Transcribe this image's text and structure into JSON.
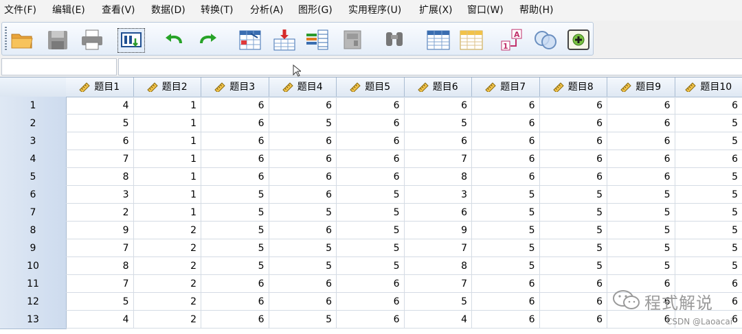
{
  "menu": [
    {
      "id": "file",
      "label": "文件(F)"
    },
    {
      "id": "edit",
      "label": "编辑(E)"
    },
    {
      "id": "view",
      "label": "查看(V)"
    },
    {
      "id": "data",
      "label": "数据(D)"
    },
    {
      "id": "transform",
      "label": "转换(T)"
    },
    {
      "id": "analyze",
      "label": "分析(A)"
    },
    {
      "id": "graphs",
      "label": "图形(G)"
    },
    {
      "id": "utilities",
      "label": "实用程序(U)"
    },
    {
      "id": "extensions",
      "label": "扩展(X)"
    },
    {
      "id": "window",
      "label": "窗口(W)"
    },
    {
      "id": "help",
      "label": "帮助(H)"
    }
  ],
  "toolbar": {
    "icons": [
      "open-folder-icon",
      "save-icon",
      "print-icon",
      "dialog-recall-icon",
      "undo-icon",
      "redo-icon",
      "goto-case-icon",
      "goto-variable-icon",
      "variables-icon",
      "run-descriptives-icon",
      "find-icon",
      "insert-cases-icon",
      "insert-variable-icon",
      "split-file-icon",
      "value-labels-icon",
      "use-sets-icon",
      "show-all-variables-icon"
    ]
  },
  "cell_editor": {
    "name": "",
    "value": ""
  },
  "grid": {
    "columns": [
      "题目1",
      "题目2",
      "题目3",
      "题目4",
      "题目5",
      "题目6",
      "题目7",
      "题目8",
      "题目9",
      "题目10"
    ],
    "rows": [
      {
        "n": "1",
        "values": [
          "4",
          "1",
          "6",
          "6",
          "6",
          "6",
          "6",
          "6",
          "6",
          "6"
        ]
      },
      {
        "n": "2",
        "values": [
          "5",
          "1",
          "6",
          "5",
          "6",
          "5",
          "6",
          "6",
          "6",
          "5"
        ]
      },
      {
        "n": "3",
        "values": [
          "6",
          "1",
          "6",
          "6",
          "6",
          "6",
          "6",
          "6",
          "6",
          "5"
        ]
      },
      {
        "n": "4",
        "values": [
          "7",
          "1",
          "6",
          "6",
          "6",
          "7",
          "6",
          "6",
          "6",
          "6"
        ]
      },
      {
        "n": "5",
        "values": [
          "8",
          "1",
          "6",
          "6",
          "6",
          "8",
          "6",
          "6",
          "6",
          "5"
        ]
      },
      {
        "n": "6",
        "values": [
          "3",
          "1",
          "5",
          "6",
          "5",
          "3",
          "5",
          "5",
          "5",
          "5"
        ]
      },
      {
        "n": "7",
        "values": [
          "2",
          "1",
          "5",
          "5",
          "5",
          "6",
          "5",
          "5",
          "5",
          "5"
        ]
      },
      {
        "n": "8",
        "values": [
          "9",
          "2",
          "5",
          "6",
          "5",
          "9",
          "5",
          "5",
          "5",
          "5"
        ]
      },
      {
        "n": "9",
        "values": [
          "7",
          "2",
          "5",
          "5",
          "5",
          "7",
          "5",
          "5",
          "5",
          "5"
        ]
      },
      {
        "n": "10",
        "values": [
          "8",
          "2",
          "5",
          "5",
          "5",
          "8",
          "5",
          "5",
          "5",
          "5"
        ]
      },
      {
        "n": "11",
        "values": [
          "7",
          "2",
          "6",
          "6",
          "6",
          "7",
          "6",
          "6",
          "6",
          "6"
        ]
      },
      {
        "n": "12",
        "values": [
          "5",
          "2",
          "6",
          "6",
          "6",
          "5",
          "6",
          "6",
          "6",
          "6"
        ]
      },
      {
        "n": "13",
        "values": [
          "4",
          "2",
          "6",
          "5",
          "6",
          "4",
          "6",
          "6",
          "6",
          "6"
        ]
      }
    ]
  },
  "watermark": {
    "title": "程式解说",
    "sub": "CSDN @Laoacai"
  }
}
